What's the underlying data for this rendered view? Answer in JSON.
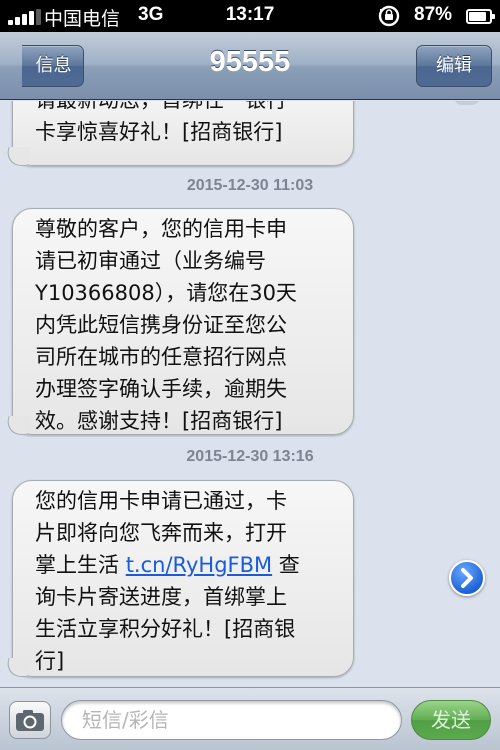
{
  "status_bar": {
    "carrier": "中国电信",
    "network": "3G",
    "time": "13:17",
    "battery": "87%",
    "battery_level": 0.87
  },
  "nav": {
    "back_label": "信息",
    "title": "95555",
    "edit_label": "编辑"
  },
  "messages": [
    {
      "lines": [
        "请最新动态，首绑任一银行",
        "卡享惊喜好礼！[招商银行]"
      ]
    },
    {
      "timestamp": "2015-12-30 11:03",
      "lines": [
        "尊敬的客户，您的信用卡申",
        "请已初审通过（业务编号",
        "Y10366808），请您在30天",
        "内凭此短信携身份证至您公",
        "司所在城市的任意招行网点",
        "办理签字确认手续，逾期失",
        "效。感谢支持！[招商银行]"
      ]
    },
    {
      "timestamp": "2015-12-30 13:16",
      "line1": "您的信用卡申请已通过，卡",
      "line2": "片即将向您飞奔而来，打开",
      "line3_prefix": "掌上生活 ",
      "link": "t.cn/RyHgFBM",
      "line3_suffix": " 查",
      "line4": "询卡片寄送进度，首绑掌上",
      "line5": "生活立享积分好礼！[招商银",
      "line6": "行]"
    }
  ],
  "input_bar": {
    "placeholder": "短信/彩信",
    "send_label": "发送"
  }
}
